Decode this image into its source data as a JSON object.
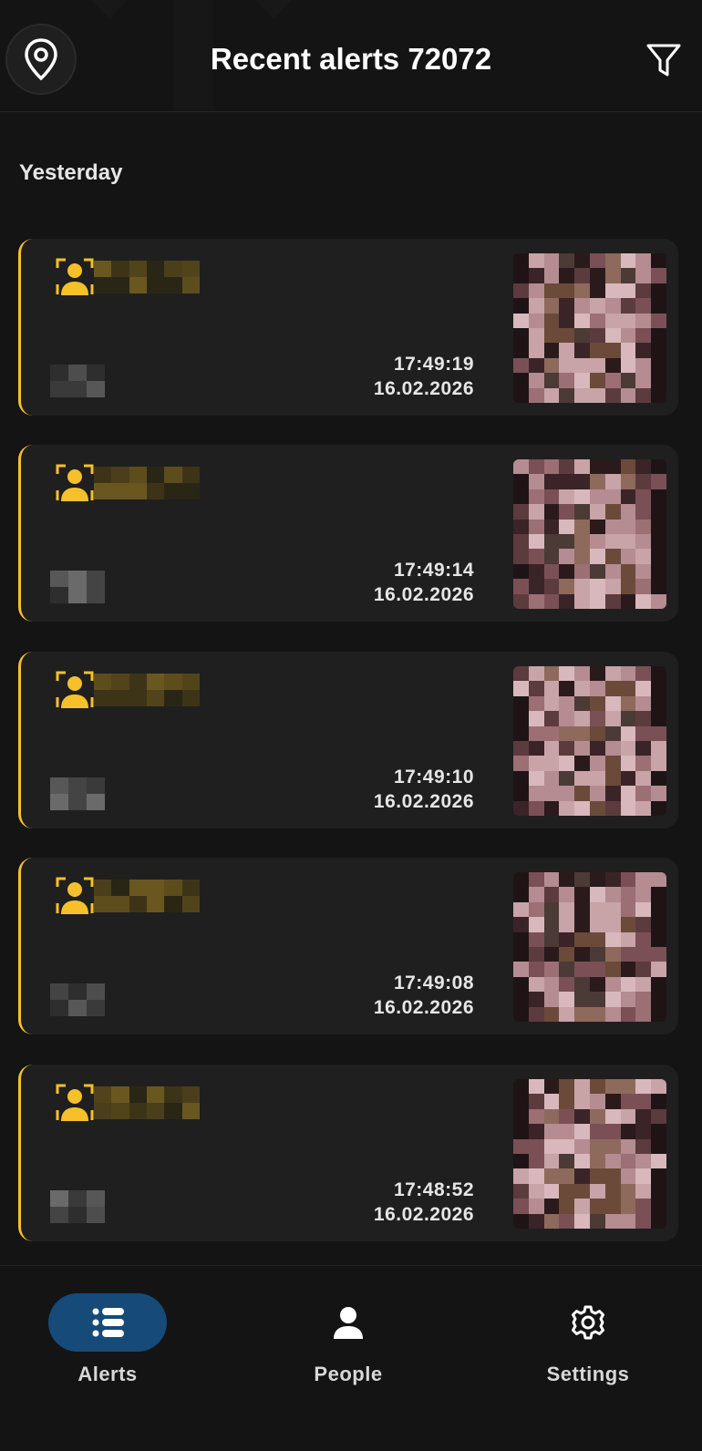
{
  "header": {
    "title": "Recent alerts 72072",
    "location_icon": "location-pin-icon",
    "filter_icon": "filter-icon"
  },
  "section_label": "Yesterday",
  "colors": {
    "accent": "#f5c02a",
    "active_nav": "#164a78",
    "card_bg": "#1f1f1f"
  },
  "alerts": [
    {
      "time": "17:49:19",
      "date": "16.02.2026",
      "type_icon": "face-recognition-icon"
    },
    {
      "time": "17:49:14",
      "date": "16.02.2026",
      "type_icon": "face-recognition-icon"
    },
    {
      "time": "17:49:10",
      "date": "16.02.2026",
      "type_icon": "face-recognition-icon"
    },
    {
      "time": "17:49:08",
      "date": "16.02.2026",
      "type_icon": "face-recognition-icon"
    },
    {
      "time": "17:48:52",
      "date": "16.02.2026",
      "type_icon": "face-recognition-icon"
    }
  ],
  "nav": {
    "items": [
      {
        "label": "Alerts",
        "icon": "list-icon",
        "active": true
      },
      {
        "label": "People",
        "icon": "person-icon",
        "active": false
      },
      {
        "label": "Settings",
        "icon": "gear-icon",
        "active": false
      }
    ]
  }
}
